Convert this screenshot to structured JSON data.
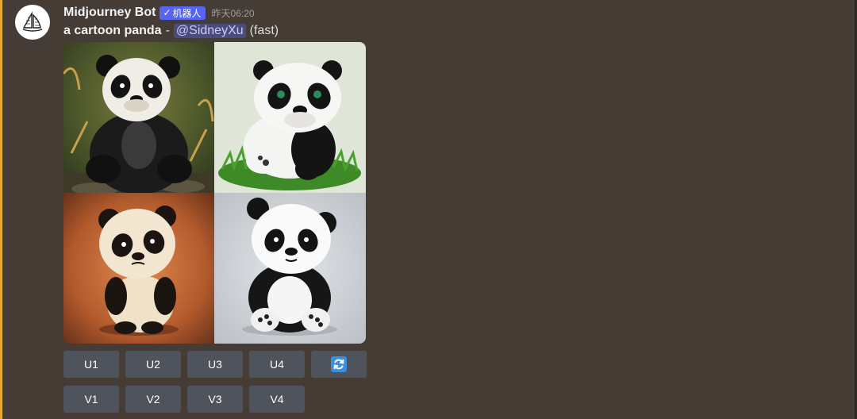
{
  "message": {
    "author": "Midjourney Bot",
    "badge": "机器人",
    "badge_check": "✓",
    "timestamp": "昨天06:20",
    "prompt": "a cartoon panda",
    "separator": "-",
    "mention": "@SidneyXu",
    "speed": "(fast)",
    "avatar_icon": "sailboat-icon"
  },
  "images": [
    {
      "name": "panda-image-1",
      "subject": "panda sitting in grass"
    },
    {
      "name": "panda-image-2",
      "subject": "panda on grass patch"
    },
    {
      "name": "panda-image-3",
      "subject": "panda on orange background"
    },
    {
      "name": "panda-image-4",
      "subject": "panda on grey background"
    }
  ],
  "buttons": {
    "upscale": [
      "U1",
      "U2",
      "U3",
      "U4"
    ],
    "variation": [
      "V1",
      "V2",
      "V3",
      "V4"
    ],
    "reroll_icon": "refresh-icon"
  },
  "colors": {
    "background": "#443c35",
    "accent_bar": "#e0a832",
    "bot_badge": "#5865f2",
    "button": "#4f545c",
    "reroll": "#3b8fdb"
  }
}
